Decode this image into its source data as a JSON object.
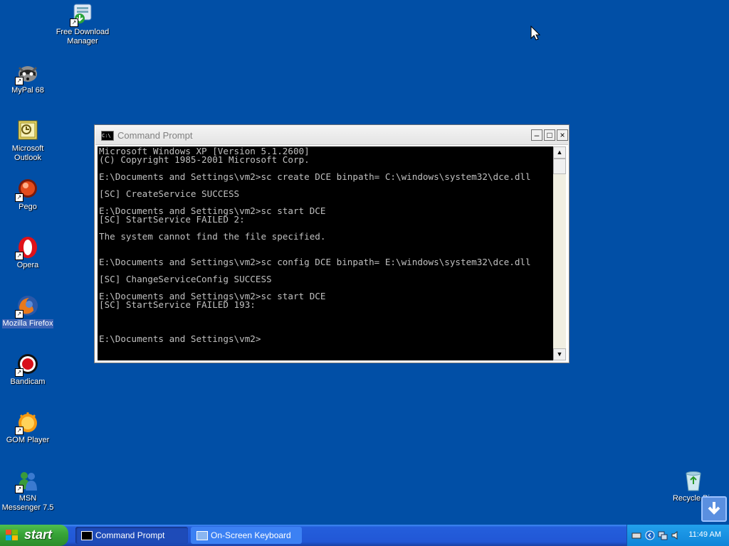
{
  "desktop": {
    "background_color": "#014fa6",
    "icons": [
      {
        "label": "Free Download Manager",
        "icon": "free-download-manager-icon"
      },
      {
        "label": "MyPal 68",
        "icon": "mypal-raccoon-icon"
      },
      {
        "label": "Microsoft Outlook",
        "icon": "outlook-icon"
      },
      {
        "label": "Pego",
        "icon": "pego-icon"
      },
      {
        "label": "Opera",
        "icon": "opera-icon"
      },
      {
        "label": "Mozilla Firefox",
        "icon": "firefox-icon"
      },
      {
        "label": "Bandicam",
        "icon": "bandicam-icon"
      },
      {
        "label": "GOM Player",
        "icon": "gom-player-icon"
      },
      {
        "label": "MSN Messenger 7.5",
        "icon": "msn-messenger-icon"
      },
      {
        "label": "Recycle Bin",
        "icon": "recycle-bin-icon"
      }
    ]
  },
  "cmd": {
    "title": "Command Prompt",
    "icon_text": "C:\\",
    "minimize": "–",
    "maximize": "□",
    "close": "×",
    "output": "Microsoft Windows XP [Version 5.1.2600]\n(C) Copyright 1985-2001 Microsoft Corp.\n\nE:\\Documents and Settings\\vm2>sc create DCE binpath= C:\\windows\\system32\\dce.dll\n\n[SC] CreateService SUCCESS\n\nE:\\Documents and Settings\\vm2>sc start DCE\n[SC] StartService FAILED 2:\n\nThe system cannot find the file specified.\n\n\nE:\\Documents and Settings\\vm2>sc config DCE binpath= E:\\windows\\system32\\dce.dll\n\n[SC] ChangeServiceConfig SUCCESS\n\nE:\\Documents and Settings\\vm2>sc start DCE\n[SC] StartService FAILED 193:\n\n\n\nE:\\Documents and Settings\\vm2>"
  },
  "taskbar": {
    "start_label": "start",
    "tasks": [
      {
        "label": "Command Prompt",
        "icon": "cmd-icon"
      },
      {
        "label": "On-Screen Keyboard",
        "icon": "keyboard-icon"
      }
    ],
    "clock": "11:49 AM"
  }
}
